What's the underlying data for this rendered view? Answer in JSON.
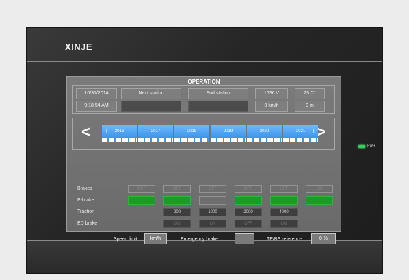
{
  "brand": "XINJE",
  "pwr_label": "PWR",
  "screen": {
    "title": "OPERATION",
    "info": {
      "date": "10/31/2014",
      "time": "9:18:54 AM",
      "next_station_label": "Next station",
      "next_station_value": "",
      "end_station_label": "End station",
      "end_station_value": "",
      "voltage": "1636 V",
      "speed": "0 km/h",
      "temperature": "25 C°",
      "distance": "0 m"
    },
    "stations": {
      "prev_arrow": "<",
      "next_arrow": ">",
      "cars": [
        "2016",
        "2017",
        "2018",
        "2019",
        "2020",
        "2021"
      ],
      "front_marker": "||",
      "rear_marker": "||"
    },
    "rows": {
      "brakes": {
        "label": "Brakes",
        "values": [
          "OFF",
          "OFF",
          "OFF",
          "OFF",
          "OFF",
          "ON"
        ]
      },
      "pbrake": {
        "label": "P-brake",
        "states": [
          "on",
          "on",
          "off",
          "on",
          "on",
          "on"
        ]
      },
      "traction": {
        "label": "Traction",
        "values": [
          "200",
          "1000",
          "2000",
          "4000"
        ]
      },
      "edbrake": {
        "label": "ED brake",
        "values": [
          "ON",
          "ON",
          "OFF",
          "ON"
        ]
      }
    },
    "bottom": {
      "speed_limit_label": "Speed limit:",
      "speed_limit_value": "km/h",
      "emergency_brake_label": "Emergency brake:",
      "emergency_brake_value": "",
      "te_be_label": "TE/BE reference:",
      "te_be_value": "0 %"
    }
  }
}
